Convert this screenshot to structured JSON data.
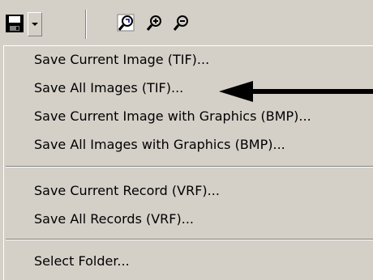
{
  "toolbar": {
    "icons": [
      "floppy-disk-icon",
      "chevron-down-icon",
      "zoom-reset-icon",
      "zoom-in-icon",
      "zoom-out-icon"
    ]
  },
  "menu": {
    "items": [
      {
        "label": "Save Current Image (TIF)..."
      },
      {
        "label": "Save All Images (TIF)..."
      },
      {
        "label": "Save Current Image with Graphics (BMP)..."
      },
      {
        "label": "Save All Images with Graphics (BMP)..."
      },
      {
        "label": "Save Current Record (VRF)..."
      },
      {
        "label": "Save All Records (VRF)..."
      },
      {
        "label": "Select Folder..."
      }
    ]
  },
  "annotation": {
    "icon": "arrow-left-icon",
    "color": "#000000"
  }
}
